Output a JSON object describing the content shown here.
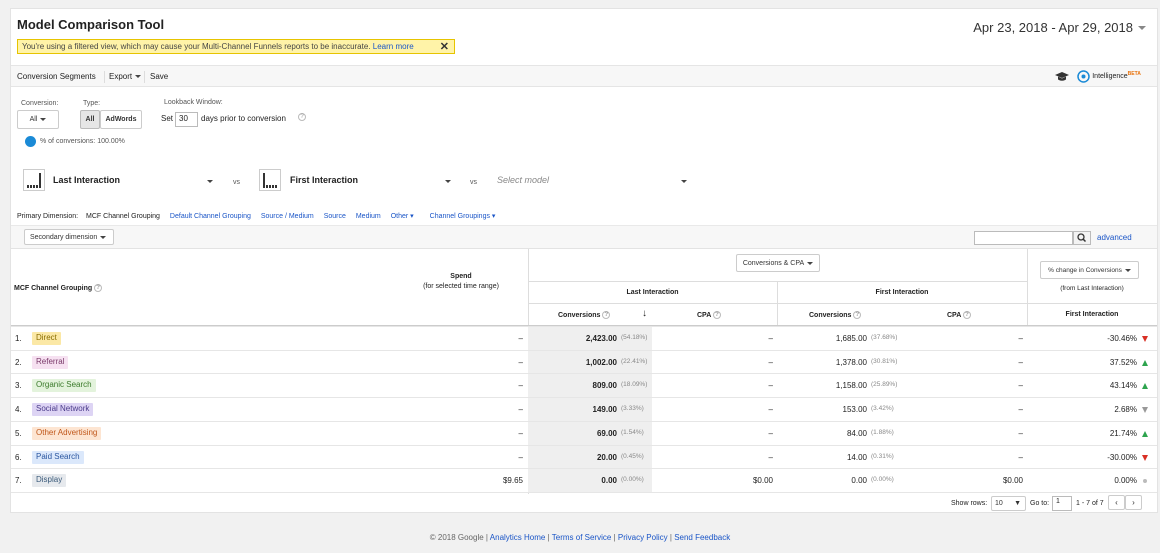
{
  "header": {
    "title": "Model Comparison Tool",
    "date_range": "Apr 23, 2018 - Apr 29, 2018"
  },
  "warning": {
    "text": "You're using a filtered view, which may cause your Multi-Channel Funnels reports to be inaccurate.",
    "link": "Learn more",
    "close": "✕"
  },
  "toolbar": {
    "conversion_segments": "Conversion Segments",
    "export": "Export",
    "save": "Save",
    "intelligence": "Intelligence",
    "beta": "BETA"
  },
  "filters": {
    "conversion_label": "Conversion:",
    "conversion_value": "All",
    "type_label": "Type:",
    "type_all": "All",
    "type_adwords": "AdWords",
    "lookback_label": "Lookback Window:",
    "lookback_set": "Set",
    "lookback_days": "30",
    "lookback_suffix": "days prior to conversion",
    "pct_conversions": "% of conversions: 100.00%"
  },
  "models": {
    "model1": "Last Interaction",
    "model2": "First Interaction",
    "vs": "vs",
    "select_placeholder": "Select model"
  },
  "primary_dimension": {
    "label": "Primary Dimension:",
    "active": "MCF Channel Grouping",
    "links": [
      "Default Channel Grouping",
      "Source / Medium",
      "Source",
      "Medium",
      "Other",
      "Channel Groupings"
    ]
  },
  "secondary_dimension": "Secondary dimension",
  "search": {
    "advanced": "advanced"
  },
  "table": {
    "col_channel": "MCF Channel Grouping",
    "col_spend": "Spend",
    "col_spend_sub": "(for selected time range)",
    "metric_select": "Conversions & CPA",
    "group_last": "Last Interaction",
    "group_first": "First Interaction",
    "col_conversions": "Conversions",
    "col_cpa": "CPA",
    "change_select": "% change in Conversions",
    "change_sub": "(from Last Interaction)",
    "change_col": "First Interaction",
    "rows": [
      {
        "idx": "1.",
        "channel": "Direct",
        "spend": "–",
        "li_conv": "2,423.00",
        "li_pct": "(54.18%)",
        "li_cpa": "–",
        "fi_conv": "1,685.00",
        "fi_pct": "(37.68%)",
        "fi_cpa": "–",
        "change": "-30.46%",
        "dir": "down"
      },
      {
        "idx": "2.",
        "channel": "Referral",
        "spend": "–",
        "li_conv": "1,002.00",
        "li_pct": "(22.41%)",
        "li_cpa": "–",
        "fi_conv": "1,378.00",
        "fi_pct": "(30.81%)",
        "fi_cpa": "–",
        "change": "37.52%",
        "dir": "up"
      },
      {
        "idx": "3.",
        "channel": "Organic Search",
        "spend": "–",
        "li_conv": "809.00",
        "li_pct": "(18.09%)",
        "li_cpa": "–",
        "fi_conv": "1,158.00",
        "fi_pct": "(25.89%)",
        "fi_cpa": "–",
        "change": "43.14%",
        "dir": "up"
      },
      {
        "idx": "4.",
        "channel": "Social Network",
        "spend": "–",
        "li_conv": "149.00",
        "li_pct": "(3.33%)",
        "li_cpa": "–",
        "fi_conv": "153.00",
        "fi_pct": "(3.42%)",
        "fi_cpa": "–",
        "change": "2.68%",
        "dir": "flat"
      },
      {
        "idx": "5.",
        "channel": "Other Advertising",
        "spend": "–",
        "li_conv": "69.00",
        "li_pct": "(1.54%)",
        "li_cpa": "–",
        "fi_conv": "84.00",
        "fi_pct": "(1.88%)",
        "fi_cpa": "–",
        "change": "21.74%",
        "dir": "up"
      },
      {
        "idx": "6.",
        "channel": "Paid Search",
        "spend": "–",
        "li_conv": "20.00",
        "li_pct": "(0.45%)",
        "li_cpa": "–",
        "fi_conv": "14.00",
        "fi_pct": "(0.31%)",
        "fi_cpa": "–",
        "change": "-30.00%",
        "dir": "down"
      },
      {
        "idx": "7.",
        "channel": "Display",
        "spend": "$9.65",
        "li_conv": "0.00",
        "li_pct": "(0.00%)",
        "li_cpa": "$0.00",
        "fi_conv": "0.00",
        "fi_pct": "(0.00%)",
        "fi_cpa": "$0.00",
        "change": "0.00%",
        "dir": "none"
      }
    ],
    "chip_colors": [
      {
        "bg": "#fbe8a6",
        "fg": "#8a6d00"
      },
      {
        "bg": "#f6e1f1",
        "fg": "#7a3a6a"
      },
      {
        "bg": "#e3f3dc",
        "fg": "#3a7a2a"
      },
      {
        "bg": "#ddd4f4",
        "fg": "#4a3a8a"
      },
      {
        "bg": "#fde5d2",
        "fg": "#c0571a"
      },
      {
        "bg": "#dbe8fb",
        "fg": "#2a56a0"
      },
      {
        "bg": "#e6e9ed",
        "fg": "#3a5a7a"
      }
    ]
  },
  "pagination": {
    "show_rows_label": "Show rows:",
    "show_rows_value": "10",
    "goto_label": "Go to:",
    "goto_value": "1",
    "range": "1 - 7 of 7"
  },
  "footer": {
    "copyright": "© 2018 Google",
    "links": [
      "Analytics Home",
      "Terms of Service",
      "Privacy Policy",
      "Send Feedback"
    ]
  },
  "colors": {
    "up": "#2da44e",
    "down": "#d93025",
    "flat": "#999999",
    "none": "#bbbbbb"
  }
}
